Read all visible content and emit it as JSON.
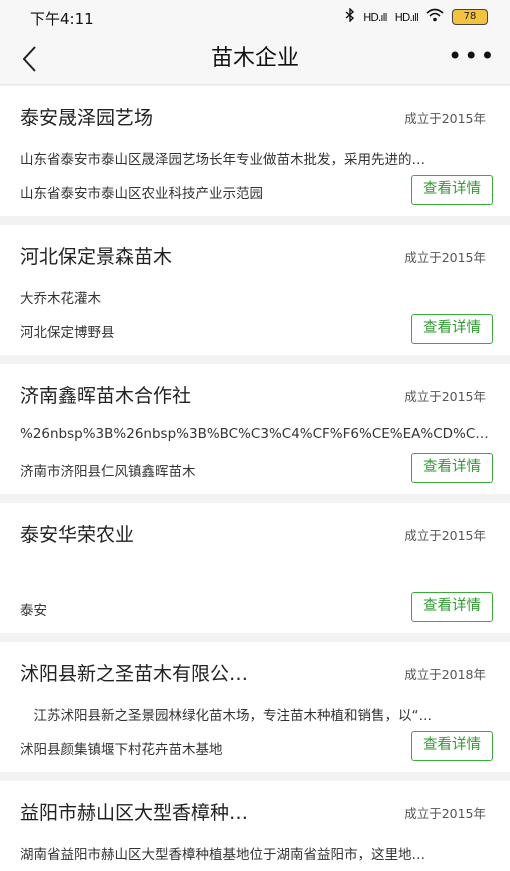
{
  "status_bar": {
    "time": "下午4:11",
    "signal1": "HD.ıll",
    "signal2": "HD.ıll",
    "battery": "78"
  },
  "header": {
    "title": "苗木企业"
  },
  "detail_label": "查看详情",
  "companies": [
    {
      "name": "泰安晟泽园艺场",
      "founded": "成立于2015年",
      "description": "山东省泰安市泰山区晟泽园艺场长年专业做苗木批发，采用先进的…",
      "address": "山东省泰安市泰山区农业科技产业示范园"
    },
    {
      "name": "河北保定景森苗木",
      "founded": "成立于2015年",
      "description": "大乔木花灌木",
      "address": "河北保定博野县"
    },
    {
      "name": "济南鑫晖苗木合作社",
      "founded": "成立于2015年",
      "description": "%26nbsp%3B%26nbsp%3B%BC%C3%C4%CF%F6%CE%EA%CD%C3…",
      "address": "济南市济阳县仁风镇鑫晖苗木"
    },
    {
      "name": "泰安华荣农业",
      "founded": "成立于2015年",
      "description": "",
      "address": "泰安"
    },
    {
      "name": "沭阳县新之圣苗木有限公…",
      "founded": "成立于2018年",
      "description": "　江苏沭阳县新之圣景园林绿化苗木场，专注苗木种植和销售，以“…",
      "address": "沭阳县颜集镇堰下村花卉苗木基地"
    },
    {
      "name": "益阳市赫山区大型香樟种…",
      "founded": "成立于2015年",
      "description": "湖南省益阳市赫山区大型香樟种植基地位于湖南省益阳市，这里地…",
      "address": ""
    }
  ]
}
